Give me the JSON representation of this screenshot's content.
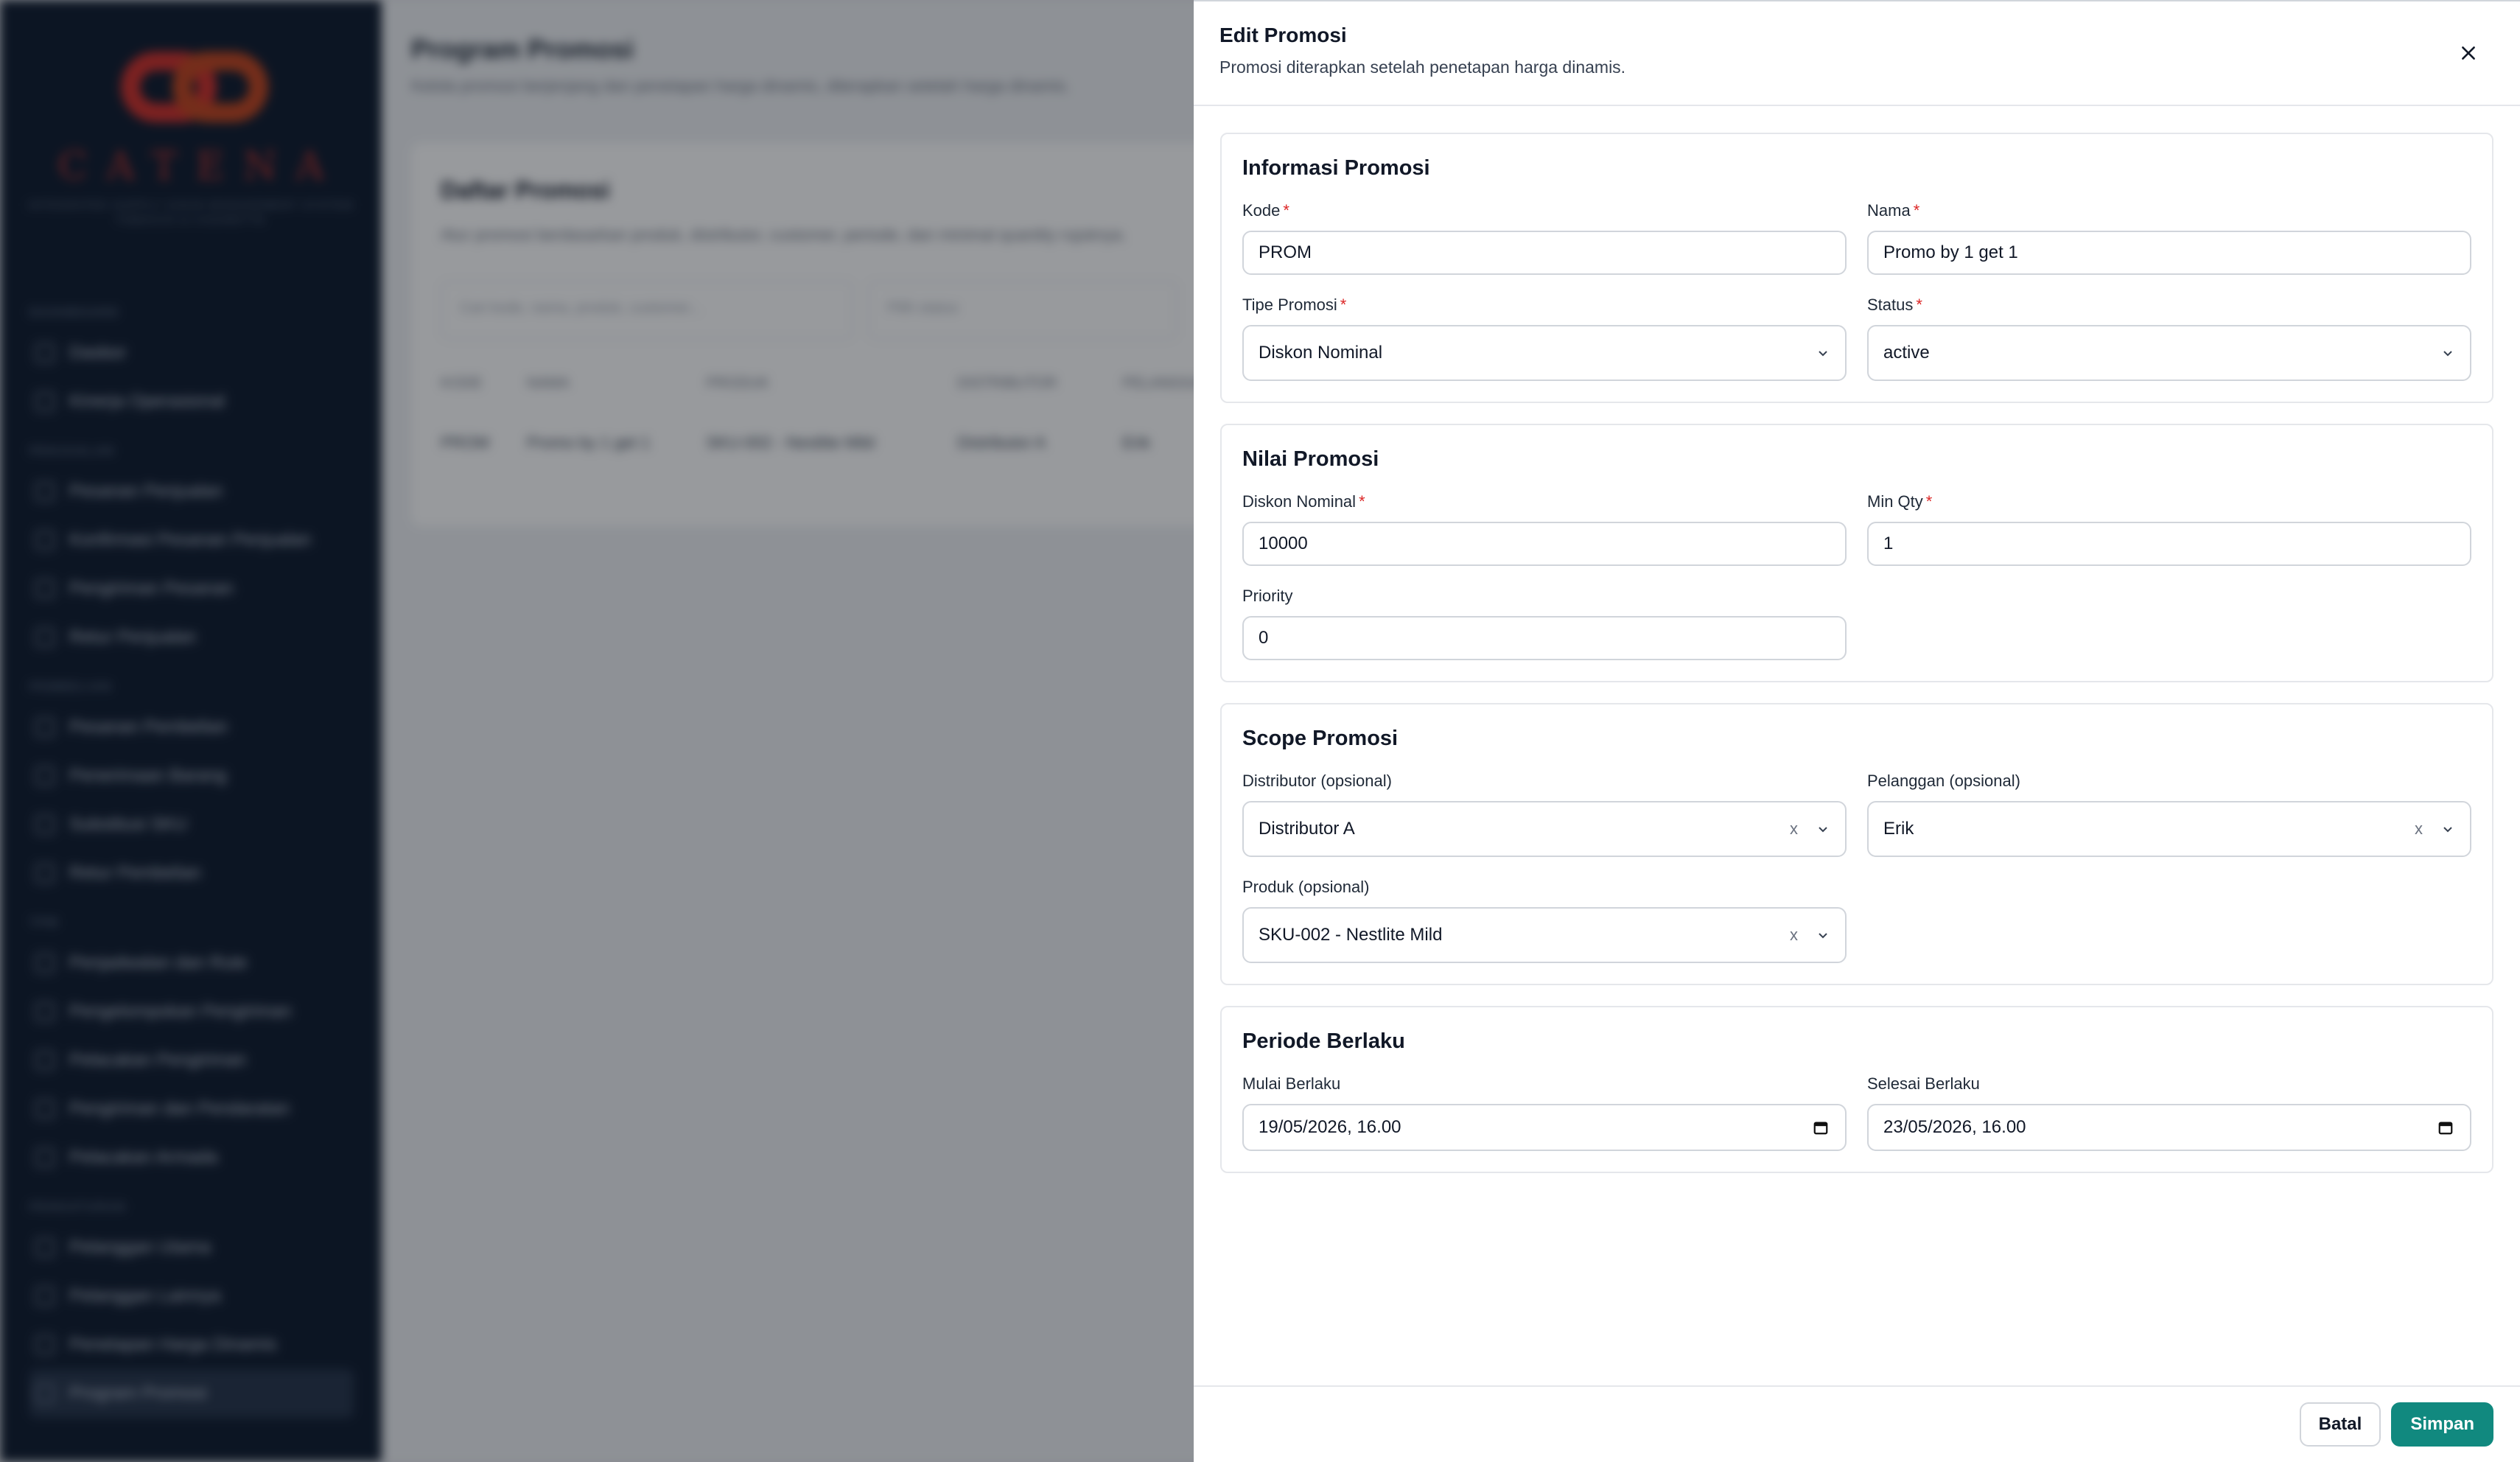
{
  "background": {
    "page_title": "Program Promosi",
    "page_subtitle": "Kelola promosi berjenjang dan penetapan harga dinamis, diterapkan setelah harga dinamis.",
    "brand": {
      "name": "CATENA",
      "tagline_1": "INTEGRATED SUPPLY CHAIN MANAGEMENT SYSTEM",
      "tagline_2": "TOBACCO & CIGARETTE"
    },
    "nav_groups": [
      {
        "label": "DASHBOARD",
        "items": [
          "Dasbor",
          "Kinerja Operasional"
        ]
      },
      {
        "label": "PENJUALAN",
        "items": [
          "Pesanan Penjualan",
          "Konfirmasi Pesanan Penjualan",
          "Pengiriman Pesanan",
          "Retur Penjualan"
        ]
      },
      {
        "label": "PEMBELIAN",
        "items": [
          "Pesanan Pembelian",
          "Penerimaan Barang",
          "Substitusi SKU",
          "Retur Pembelian"
        ]
      },
      {
        "label": "TPM",
        "items": [
          "Penjadwalan dan Rute",
          "Pengelompokan Pengiriman",
          "Pelacakan Pengiriman",
          "Pengiriman dan Pendaratan",
          "Pelacakan Armada"
        ]
      },
      {
        "label": "PENGATURAN",
        "items": [
          "Pelanggan Utama",
          "Pelanggan Lainnya",
          "Penetapan Harga Dinamis",
          "Program Promosi"
        ]
      }
    ],
    "card": {
      "title": "Daftar Promosi",
      "description": "Atur promosi berdasarkan produk, distributor, customer, periode, dan minimal quantity rujuknya.",
      "search_placeholder": "Cari kode, nama, produk, customer...",
      "status_filter": "Pilih status",
      "columns": [
        "KODE",
        "NAMA",
        "PRODUK",
        "DISTRIBUTOR",
        "PELANGGAN"
      ],
      "row": [
        "PROM",
        "Promo by 1 get 1",
        "SKU-002 - Nestlite Mild",
        "Distributor A",
        "Erik"
      ]
    }
  },
  "drawer": {
    "title": "Edit Promosi",
    "subtitle": "Promosi diterapkan setelah penetapan harga dinamis.",
    "sections": {
      "info": {
        "title": "Informasi Promosi",
        "kode_label": "Kode",
        "kode_value": "PROM",
        "nama_label": "Nama",
        "nama_value": "Promo by 1 get 1",
        "tipe_label": "Tipe Promosi",
        "tipe_value": "Diskon Nominal",
        "status_label": "Status",
        "status_value": "active"
      },
      "nilai": {
        "title": "Nilai Promosi",
        "diskon_label": "Diskon Nominal",
        "diskon_value": "10000",
        "minqty_label": "Min Qty",
        "minqty_value": "1",
        "priority_label": "Priority",
        "priority_value": "0"
      },
      "scope": {
        "title": "Scope Promosi",
        "distributor_label": "Distributor (opsional)",
        "distributor_value": "Distributor A",
        "pelanggan_label": "Pelanggan (opsional)",
        "pelanggan_value": "Erik",
        "produk_label": "Produk (opsional)",
        "produk_value": "SKU-002 - Nestlite Mild",
        "clear_glyph": "x"
      },
      "periode": {
        "title": "Periode Berlaku",
        "mulai_label": "Mulai Berlaku",
        "mulai_value": "19/05/2026, 16.00",
        "selesai_label": "Selesai Berlaku",
        "selesai_value": "23/05/2026, 16.00"
      }
    },
    "required_mark": "*",
    "buttons": {
      "cancel": "Batal",
      "save": "Simpan"
    }
  },
  "colors": {
    "primary": "#11897f",
    "required": "#dc2626",
    "sidebar": "#0f1b2e"
  }
}
